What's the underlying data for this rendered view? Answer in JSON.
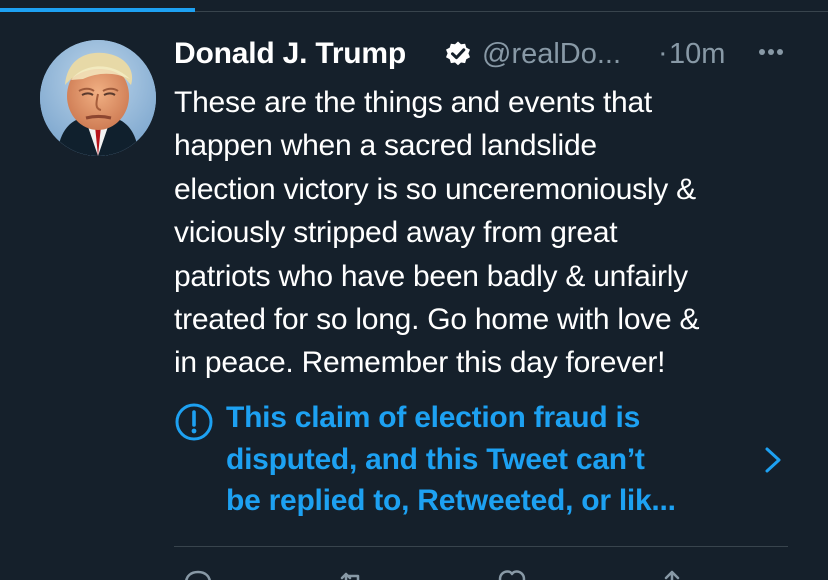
{
  "screen": {
    "progress_fraction": 0.235
  },
  "tweet": {
    "author_name": "Donald J. Trump",
    "handle": "@realDo...",
    "separator": "·",
    "time_ago": "10m",
    "text": "These are the things and events that\nhappen when a sacred landslide\nelection victory is so unceremoniously &\nviciously stripped away from great\npatriots who have been badly & unfairly\ntreated for so long. Go home with love &\nin peace. Remember this day forever!",
    "notice": "This claim of election fraud is\ndisputed, and this Tweet can’t\nbe replied to, Retweeted, or lik..."
  },
  "icons": {
    "verified": "verified-badge-icon",
    "more": "more-options-icon",
    "notice": "exclamation-circle-icon",
    "chevron": "chevron-right-icon",
    "reply": "reply-icon",
    "retweet": "retweet-icon",
    "like": "heart-icon",
    "share": "share-icon"
  },
  "colors": {
    "background": "#15202b",
    "primary_text": "#ffffff",
    "secondary_text": "#8899a6",
    "accent": "#1da1f2",
    "divider": "#38444d"
  }
}
